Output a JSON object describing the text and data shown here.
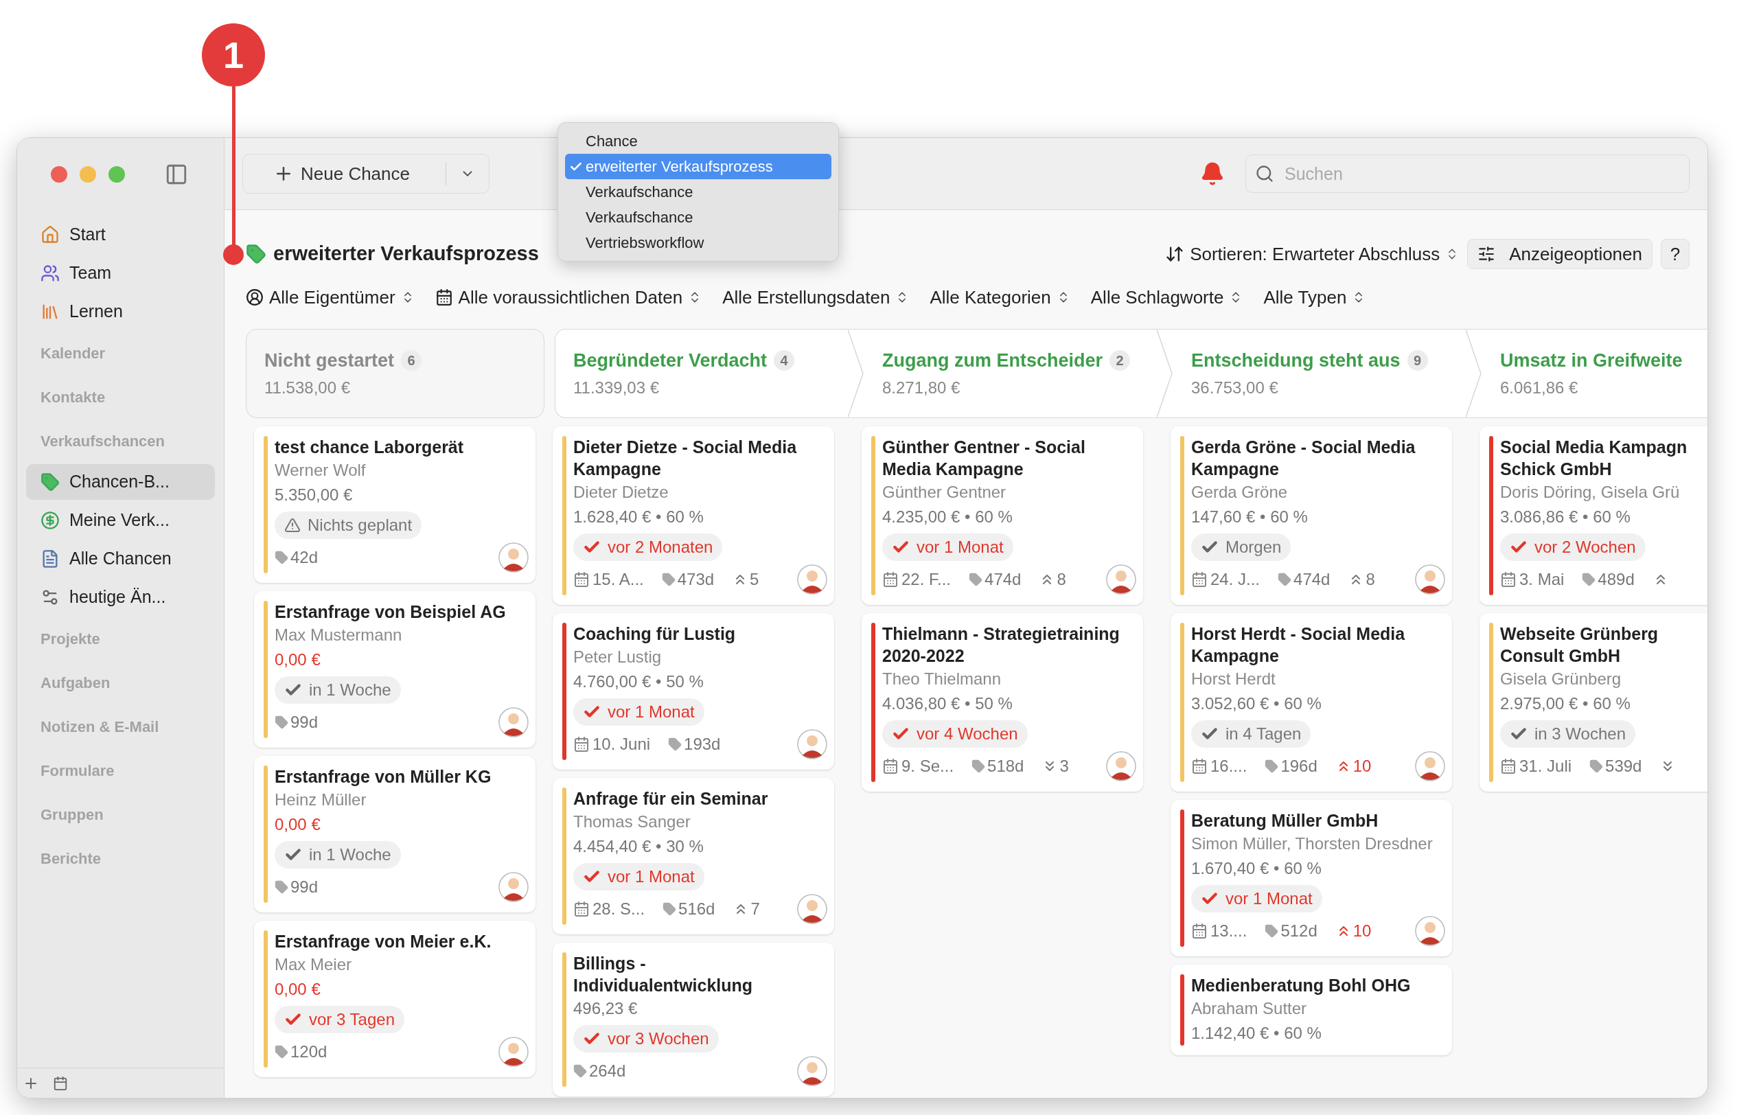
{
  "annotation": {
    "label": "1"
  },
  "window": {
    "sidebar": {
      "entries": [
        {
          "kind": "item",
          "label": "Start",
          "selected": false
        },
        {
          "kind": "item",
          "label": "Team",
          "selected": false
        },
        {
          "kind": "item",
          "label": "Lernen",
          "selected": false
        },
        {
          "kind": "heading",
          "label": "Kalender"
        },
        {
          "kind": "heading",
          "label": "Kontakte"
        },
        {
          "kind": "heading",
          "label": "Verkaufschancen"
        },
        {
          "kind": "item",
          "label": "Chancen-B...",
          "selected": true
        },
        {
          "kind": "item",
          "label": "Meine Verk...",
          "selected": false
        },
        {
          "kind": "item",
          "label": "Alle Chancen",
          "selected": false
        },
        {
          "kind": "item",
          "label": "heutige Än...",
          "selected": false
        },
        {
          "kind": "heading",
          "label": "Projekte"
        },
        {
          "kind": "heading",
          "label": "Aufgaben"
        },
        {
          "kind": "heading",
          "label": "Notizen & E-Mail"
        },
        {
          "kind": "heading",
          "label": "Formulare"
        },
        {
          "kind": "heading",
          "label": "Gruppen"
        },
        {
          "kind": "heading",
          "label": "Berichte"
        }
      ]
    },
    "toolbar": {
      "new_button": "Neue Chance",
      "search": {
        "placeholder": "Suchen"
      }
    },
    "type_menu": {
      "items": [
        {
          "label": "Chance",
          "selected": false
        },
        {
          "label": "erweiterter Verkaufsprozess",
          "selected": true
        },
        {
          "label": "Verkaufschance",
          "selected": false
        },
        {
          "label": "Verkaufschance",
          "selected": false
        },
        {
          "label": "Vertriebsworkflow",
          "selected": false
        }
      ]
    },
    "header": {
      "title": "erweiterter Verkaufsprozess",
      "sort": "Sortieren: Erwarteter Abschluss",
      "options_button": "Anzeigeoptionen",
      "help_button": "?"
    },
    "filters": [
      "Alle Eigentümer",
      "Alle voraussichtlichen Daten",
      "Alle Erstellungsdaten",
      "Alle Kategorien",
      "Alle Schlagworte",
      "Alle Typen"
    ],
    "stages": [
      {
        "kind": "start",
        "title": "Nicht gestartet",
        "count": "6",
        "total": "11.538,00 €",
        "cards": [
          {
            "title": "test chance Laborgerät",
            "person": "Werner Wolf",
            "amount": "5.350,00 €",
            "amount_alert": false,
            "color": "#f2c462",
            "chip": {
              "kind": "unplanned",
              "text": "Nichts geplant"
            },
            "age": "42d"
          },
          {
            "title": "Erstanfrage von Beispiel AG",
            "person": "Max Mustermann",
            "amount": "0,00 €",
            "amount_alert": true,
            "color": "#f2c462",
            "chip": {
              "kind": "upcoming",
              "text": "in 1 Woche"
            },
            "age": "99d"
          },
          {
            "title": "Erstanfrage von Müller KG",
            "person": "Heinz Müller",
            "amount": "0,00 €",
            "amount_alert": true,
            "color": "#f2c462",
            "chip": {
              "kind": "upcoming",
              "text": "in 1 Woche"
            },
            "age": "99d"
          },
          {
            "title": "Erstanfrage von Meier e.K.",
            "person": "Max Meier",
            "amount": "0,00 €",
            "amount_alert": true,
            "color": "#f2c462",
            "chip": {
              "kind": "overdue",
              "text": "vor 3 Tagen"
            },
            "age": "120d"
          }
        ]
      },
      {
        "kind": "stage",
        "title": "Begründeter Verdacht",
        "count": "4",
        "total": "11.339,03 €",
        "cards": [
          {
            "title": "Dieter Dietze - Social Media Kampagne",
            "person": "Dieter Dietze",
            "amount": "1.628,40 € • 60 %",
            "amount_alert": false,
            "color": "#f2c462",
            "chip": {
              "kind": "overdue",
              "text": "vor 2 Monaten"
            },
            "date": "15. A...",
            "age": "473d",
            "priority": {
              "kind": "up",
              "count": "5",
              "alert": false
            }
          },
          {
            "title": "Coaching für Lustig",
            "person": "Peter Lustig",
            "amount": "4.760,00 € • 50 %",
            "amount_alert": false,
            "color": "#e2362b",
            "chip": {
              "kind": "overdue",
              "text": "vor 1 Monat"
            },
            "date": "10. Juni",
            "age": "193d"
          },
          {
            "title": "Anfrage für ein Seminar",
            "person": "Thomas Sanger",
            "amount": "4.454,40 € • 30 %",
            "amount_alert": false,
            "color": "#f2c462",
            "chip": {
              "kind": "overdue",
              "text": "vor 1 Monat"
            },
            "date": "28. S...",
            "age": "516d",
            "priority": {
              "kind": "up",
              "count": "7",
              "alert": false
            }
          },
          {
            "title": "Billings - Individualentwicklung",
            "amount": "496,23 €",
            "amount_alert": false,
            "color": "#f2c462",
            "chip": {
              "kind": "overdue",
              "text": "vor 3 Wochen"
            },
            "age": "264d"
          }
        ]
      },
      {
        "kind": "stage",
        "title": "Zugang zum Entscheider",
        "count": "2",
        "total": "8.271,80 €",
        "cards": [
          {
            "title": "Günther Gentner - Social Media Kampagne",
            "person": "Günther Gentner",
            "amount": "4.235,00 € • 60 %",
            "amount_alert": false,
            "color": "#f2c462",
            "chip": {
              "kind": "overdue",
              "text": "vor 1 Monat"
            },
            "date": "22. F...",
            "age": "474d",
            "priority": {
              "kind": "up",
              "count": "8",
              "alert": false
            }
          },
          {
            "title": "Thielmann - Strategietraining 2020-2022",
            "person": "Theo Thielmann",
            "amount": "4.036,80 € • 50 %",
            "amount_alert": false,
            "color": "#e2362b",
            "chip": {
              "kind": "overdue",
              "text": "vor 4 Wochen"
            },
            "date": "9. Se...",
            "age": "518d",
            "priority": {
              "kind": "down",
              "count": "3",
              "alert": false
            }
          }
        ]
      },
      {
        "kind": "stage",
        "title": "Entscheidung steht aus",
        "count": "9",
        "total": "36.753,00 €",
        "cards": [
          {
            "title": "Gerda Gröne - Social Media Kampagne",
            "person": "Gerda Gröne",
            "amount": "147,60 € • 60 %",
            "amount_alert": false,
            "color": "#f2c462",
            "chip": {
              "kind": "upcoming",
              "text": "Morgen"
            },
            "date": "24. J...",
            "age": "474d",
            "priority": {
              "kind": "up",
              "count": "8",
              "alert": false
            }
          },
          {
            "title": "Horst Herdt - Social Media Kampagne",
            "person": "Horst Herdt",
            "amount": "3.052,60 € • 60 %",
            "amount_alert": false,
            "color": "#f2c462",
            "chip": {
              "kind": "upcoming",
              "text": "in 4 Tagen"
            },
            "date": "16....",
            "age": "196d",
            "priority": {
              "kind": "up",
              "count": "10",
              "alert": true
            }
          },
          {
            "title": "Beratung Müller GmbH",
            "person": "Simon Müller, Thorsten Dresdner",
            "amount": "1.670,40 € • 60 %",
            "amount_alert": false,
            "color": "#e2362b",
            "chip": {
              "kind": "overdue",
              "text": "vor 1 Monat"
            },
            "date": "13....",
            "age": "512d",
            "priority": {
              "kind": "up",
              "count": "10",
              "alert": true
            }
          },
          {
            "title": "Medienberatung Bohl OHG",
            "person": "Abraham  Sutter",
            "amount": "1.142,40 € • 60 %",
            "amount_alert": false,
            "color": "#e2362b"
          }
        ]
      },
      {
        "kind": "stage",
        "title": "Umsatz in Greifweite",
        "total": "6.061,86 €",
        "cards": [
          {
            "title": "Social Media Kampagn\nSchick GmbH",
            "person": "Doris Döring, Gisela Grü",
            "amount": "3.086,86 € • 60 %",
            "amount_alert": false,
            "color": "#e2362b",
            "chip": {
              "kind": "overdue",
              "text": "vor 2 Wochen"
            },
            "date": "3. Mai",
            "age": "489d",
            "priority": {
              "kind": "up",
              "alert": false
            }
          },
          {
            "title": "Webseite Grünberg\nConsult GmbH",
            "person": "Gisela Grünberg",
            "amount": "2.975,00 € • 60 %",
            "amount_alert": false,
            "color": "#f2c462",
            "chip": {
              "kind": "upcoming",
              "text": "in 3 Wochen"
            },
            "date": "31. Juli",
            "age": "539d",
            "priority": {
              "kind": "down",
              "alert": false
            }
          }
        ]
      }
    ]
  }
}
